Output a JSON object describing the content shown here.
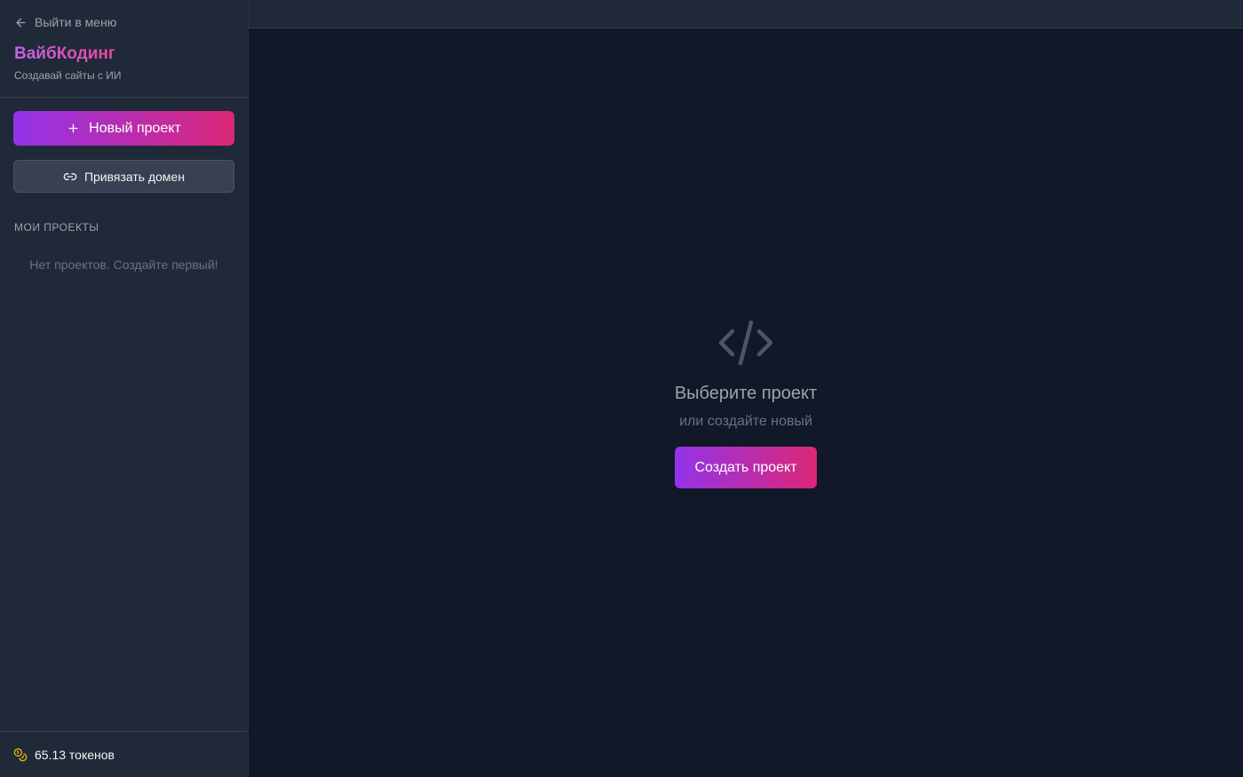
{
  "sidebar": {
    "back_label": "Выйти в меню",
    "brand": "ВайбКодинг",
    "tagline": "Создавай сайты с ИИ",
    "new_project_label": "Новый проект",
    "bind_domain_label": "Привязать домен",
    "projects_section_title": "МОИ ПРОЕКТЫ",
    "projects_empty": "Нет проектов. Создайте первый!",
    "tokens": "65.13 токенов"
  },
  "main": {
    "empty_title": "Выберите проект",
    "empty_subtitle": "или создайте новый",
    "create_label": "Создать проект"
  },
  "colors": {
    "accent_start": "#9333ea",
    "accent_end": "#db2777",
    "coin": "#eab308"
  },
  "icons": {
    "back": "arrow-left-icon",
    "plus": "plus-icon",
    "link": "link-icon",
    "code": "code-icon",
    "coins": "coins-icon"
  }
}
